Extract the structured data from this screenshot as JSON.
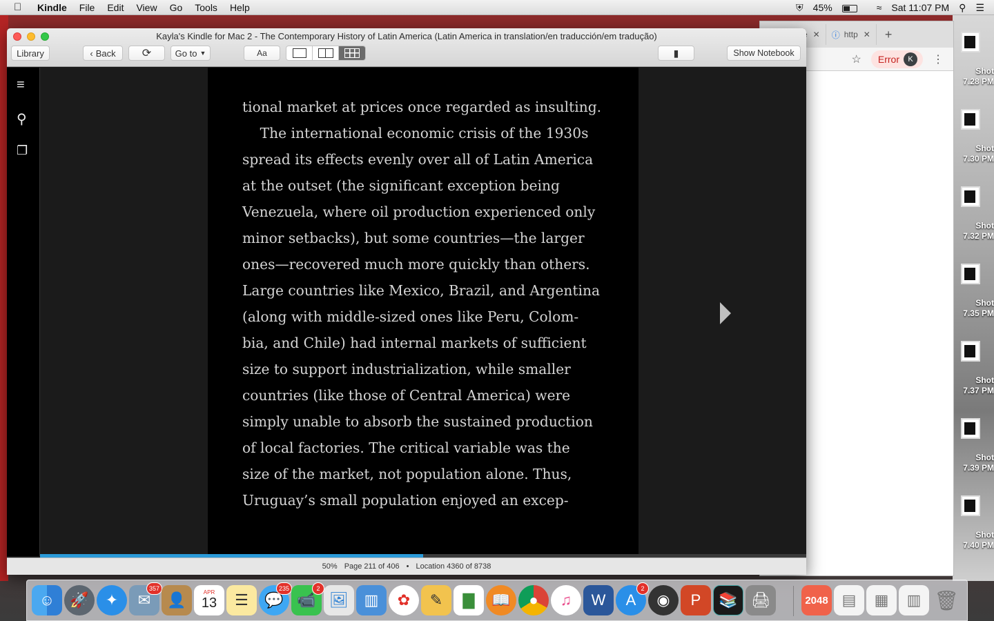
{
  "menubar": {
    "app_name": "Kindle",
    "items": [
      "File",
      "Edit",
      "View",
      "Go",
      "Tools",
      "Help"
    ],
    "battery_percent": "45%",
    "clock": "Sat 11:07 PM"
  },
  "window": {
    "title": "Kayla's Kindle for Mac 2 - The Contemporary History of Latin America (Latin America in translation/en traducción/em tradução)"
  },
  "toolbar": {
    "library_label": "Library",
    "back_label": "Back",
    "goto_label": "Go to",
    "font_label": "Aa",
    "show_notebook_label": "Show Notebook"
  },
  "book": {
    "lines": [
      "tional market at prices once regarded as insulting.",
      "    The international economic crisis of the 1930s",
      "spread its effects evenly over all of Latin America",
      "at the outset (the significant exception being",
      "Venezuela, where oil production experienced only",
      "minor setbacks), but some countries—the larger",
      "ones—recovered much more quickly than others.",
      "Large countries like Mexico, Brazil, and Argentina",
      "(along with middle-sized ones like Peru, Colom-",
      "bia, and Chile) had internal markets of sufficient",
      "size to support industrialization, while smaller",
      "countries (like those of Central America) were",
      "simply unable to absorb the sustained production",
      "of local factories. The critical variable was the",
      "size of the market, not population alone. Thus,",
      "Uruguay’s small population enjoyed an excep-"
    ]
  },
  "status": {
    "percent": "50%",
    "page": "Page 211 of 406",
    "separator": "•",
    "location": "Location 4360 of 8738",
    "progress_fraction": 0.5
  },
  "chrome": {
    "tab1": "re",
    "tab2": "http",
    "error_label": "Error",
    "avatar_letter": "K"
  },
  "desktop_shots": [
    {
      "label": "Shot",
      "time": "7.28 PM"
    },
    {
      "label": "Shot",
      "time": "7.30 PM"
    },
    {
      "label": "Shot",
      "time": "7.32 PM"
    },
    {
      "label": "Shot",
      "time": "7.35 PM"
    },
    {
      "label": "Shot",
      "time": "7.37 PM"
    },
    {
      "label": "Shot",
      "time": "7.39 PM"
    },
    {
      "label": "Shot",
      "time": "7.40 PM"
    }
  ],
  "dock": {
    "mail_badge": "357",
    "calendar_month": "APR",
    "calendar_day": "13",
    "messages_badge": "235",
    "facetime_badge": "2",
    "appstore_badge": "2",
    "game_label": "2048"
  },
  "colors": {
    "accent_progress": "#2a9ad8",
    "page_bg": "#000000",
    "text": "#d4d4d4"
  }
}
